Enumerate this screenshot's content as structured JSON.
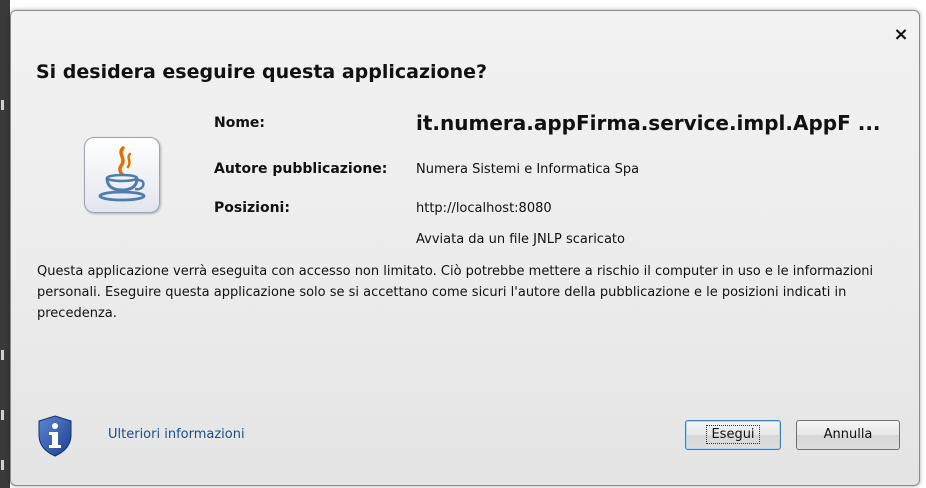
{
  "dialog": {
    "title": "Si desidera eseguire questa applicazione?",
    "close_symbol": "×",
    "icon": "java-coffee-cup-icon",
    "fields": {
      "name_label": "Nome:",
      "name_value": "it.numera.appFirma.service.impl.AppF ...",
      "publisher_label": "Autore pubblicazione:",
      "publisher_value": "Numera Sistemi e Informatica Spa",
      "locations_label": "Posizioni:",
      "location_value": "http://localhost:8080",
      "location_note": "Avviata da un file JNLP scaricato"
    },
    "warning": "Questa applicazione verrà eseguita con accesso non limitato. Ciò potrebbe mettere a rischio il computer in uso e le informazioni personali. Eseguire questa applicazione solo se si accettano come sicuri l'autore della pubblicazione e le posizioni indicati in precedenza.",
    "more_info_icon": "info-shield-icon",
    "more_info_link": "Ulteriori informazioni",
    "buttons": {
      "run": "Esegui",
      "cancel": "Annulla"
    }
  },
  "colors": {
    "link": "#1c4e86",
    "shield": "#2b4fa2",
    "default_button_border": "#3c7fb1"
  }
}
